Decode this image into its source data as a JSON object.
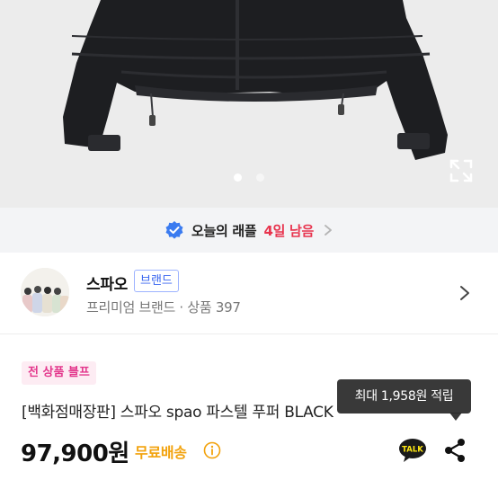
{
  "gallery": {
    "current_index": 1,
    "total": 2,
    "expand_icon": "expand-icon"
  },
  "raffle": {
    "label": "오늘의 래플",
    "days_left": "4일 남음",
    "icon": "verified-check-icon",
    "accent_color": "#e8344e",
    "check_color": "#3a7bf0"
  },
  "brand": {
    "name": "스파오",
    "badge": "브랜드",
    "subtitle": "프리미엄 브랜드 · 상품 397"
  },
  "product": {
    "tag": "전 상품 블프",
    "title": "[백화점매장판] 스파오 spao 파스텔 푸퍼 BLACK",
    "price": "97,900원",
    "shipping": "무료배송",
    "shipping_color": "#f2a20c"
  },
  "actions": {
    "kakao_label": "TALK",
    "share_icon": "share-icon",
    "tooltip": "최대 1,958원 적립"
  }
}
